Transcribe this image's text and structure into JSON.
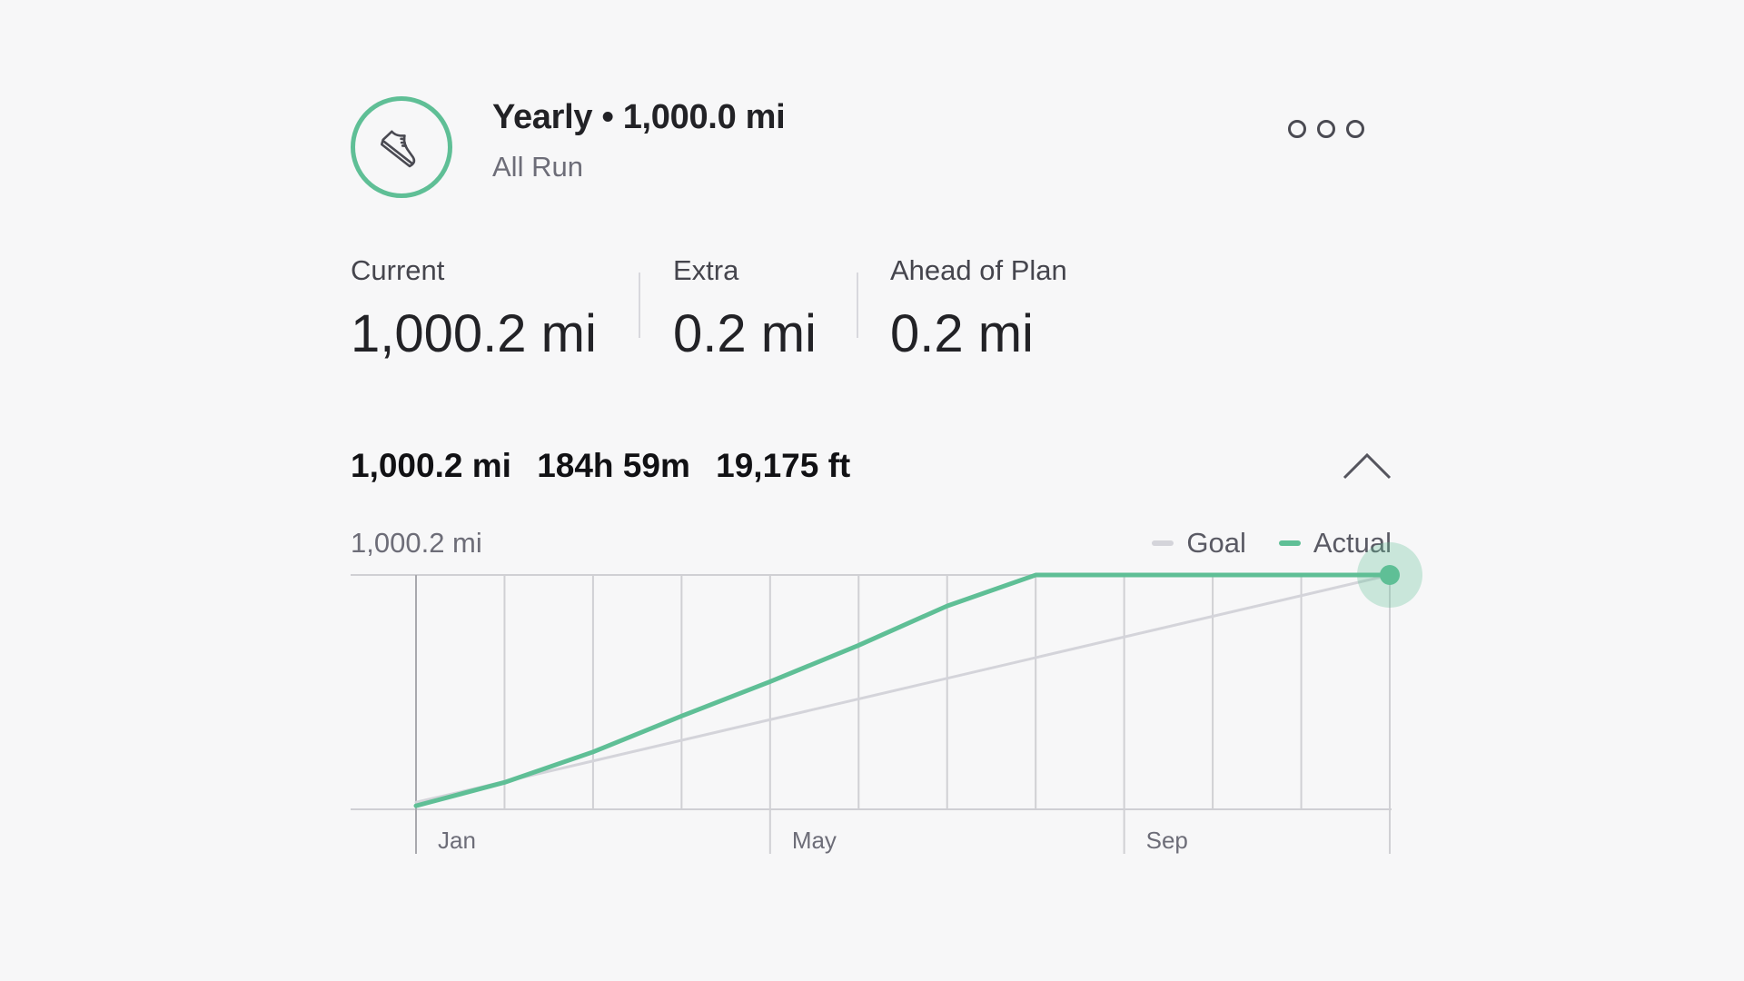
{
  "header": {
    "title": "Yearly • 1,000.0 mi",
    "subtitle": "All Run",
    "icon": "running-shoe-icon",
    "more_icon": "more-options-icon"
  },
  "stats": [
    {
      "label": "Current",
      "value": "1,000.2 mi"
    },
    {
      "label": "Extra",
      "value": "0.2 mi"
    },
    {
      "label": "Ahead of Plan",
      "value": "0.2 mi"
    }
  ],
  "summary": {
    "distance": "1,000.2 mi",
    "time": "184h 59m",
    "elevation": "19,175 ft",
    "collapse_icon": "chevron-up-icon"
  },
  "colors": {
    "accent": "#5fbf96",
    "goal": "#d4d4da",
    "grid": "#d0d0d4"
  },
  "chart_data": {
    "type": "line",
    "y_label": "1,000.2 mi",
    "ylim": [
      0,
      1000.2
    ],
    "x_ticks": [
      "Jan",
      "May",
      "Sep"
    ],
    "x_tick_months": [
      0,
      4,
      8
    ],
    "months": 11,
    "series": [
      {
        "name": "Goal",
        "color": "#d4d4da",
        "x": [
          0,
          11
        ],
        "values": [
          30,
          1000.2
        ]
      },
      {
        "name": "Actual",
        "color": "#5fbf96",
        "x": [
          0,
          1,
          2,
          3,
          4,
          5,
          6,
          7,
          8,
          9,
          10,
          11
        ],
        "values": [
          15,
          115,
          245,
          398,
          545,
          700,
          868,
          1000,
          1000,
          1000,
          1000,
          1000.2
        ]
      }
    ],
    "legend": "top-right",
    "grid": true
  }
}
